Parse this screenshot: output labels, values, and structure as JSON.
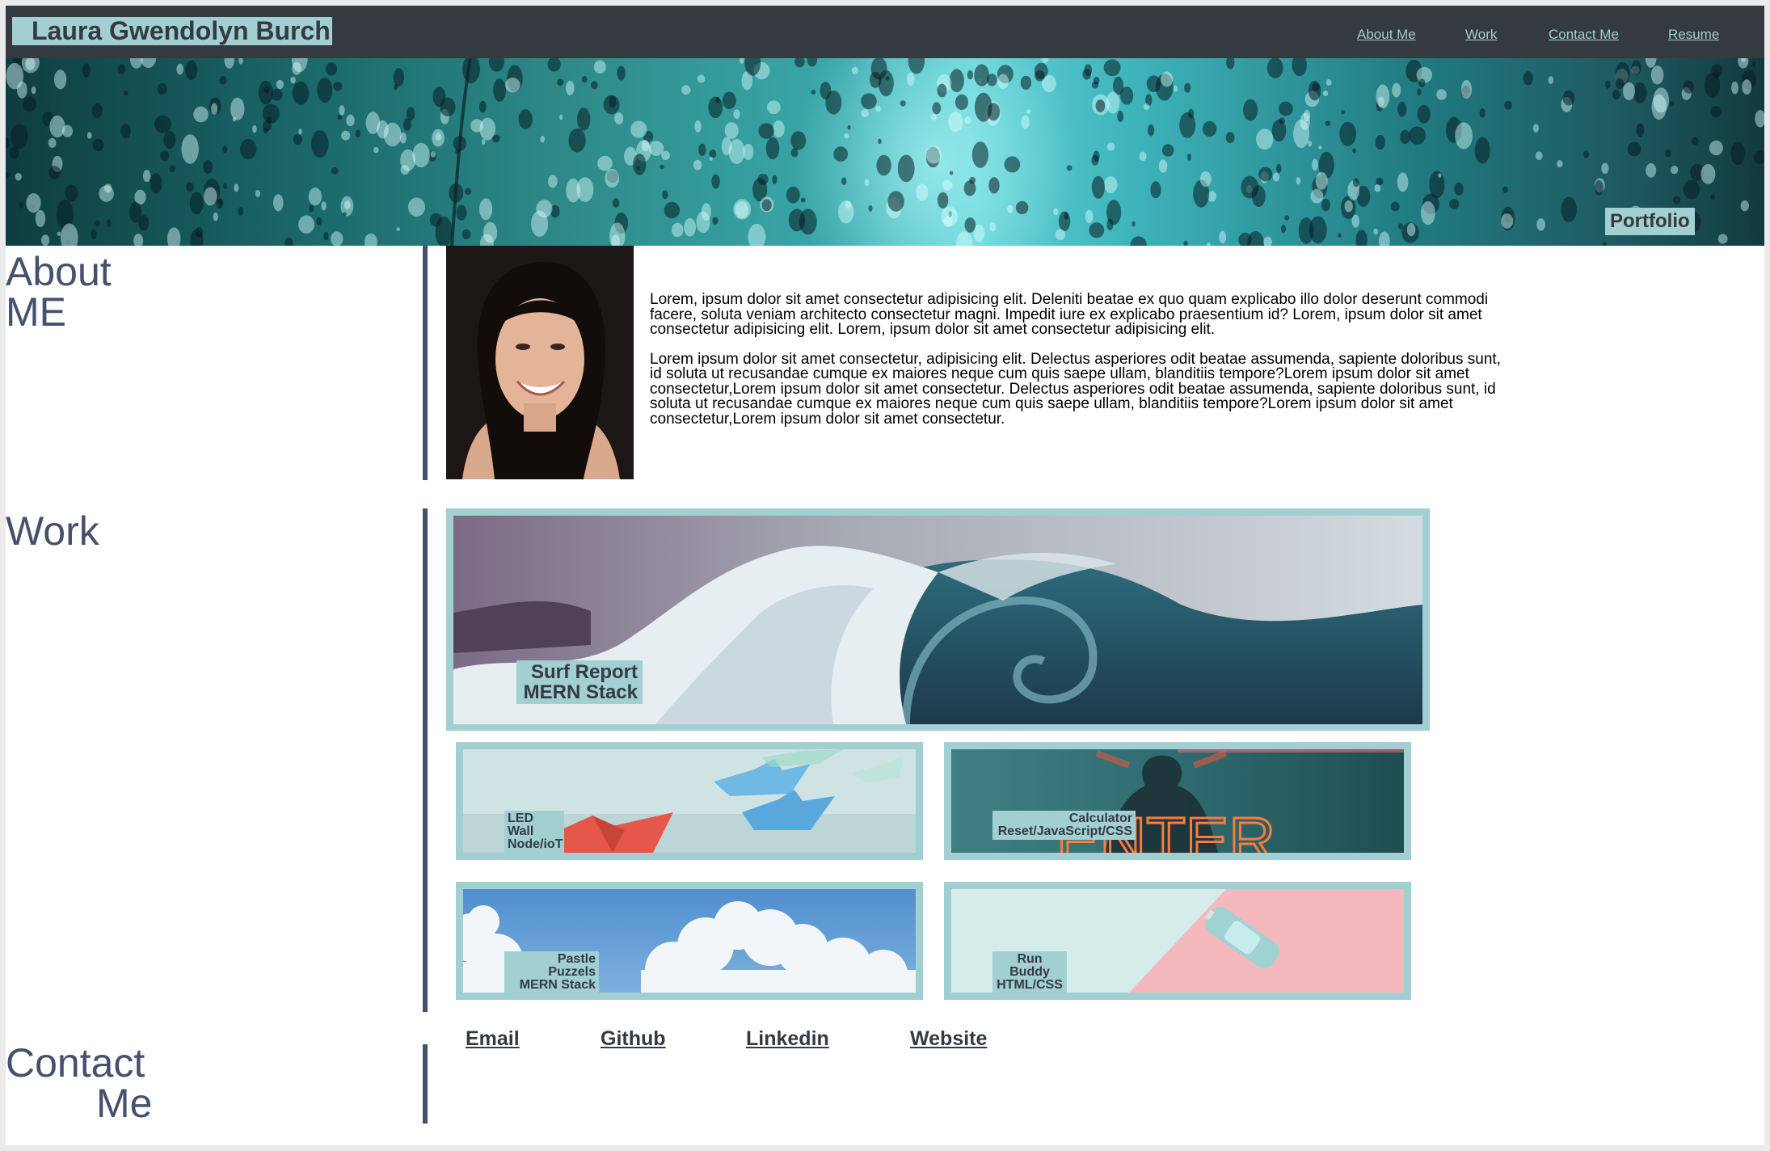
{
  "header": {
    "site_title": "Laura Gwendolyn Burch",
    "nav": [
      "About Me",
      "Work",
      "Contact Me",
      "Resume"
    ]
  },
  "hero": {
    "tag": "Portfolio"
  },
  "about": {
    "heading_line1": "About",
    "heading_line2": "ME",
    "paragraphs": [
      "Lorem, ipsum dolor sit amet consectetur adipisicing elit. Deleniti beatae ex quo quam explicabo illo dolor deserunt commodi facere, soluta veniam architecto consectetur magni. Impedit iure ex explicabo praesentium id? Lorem, ipsum dolor sit amet consectetur adipisicing elit. Lorem, ipsum dolor sit amet consectetur adipisicing elit.",
      "Lorem ipsum dolor sit amet consectetur, adipisicing elit. Delectus asperiores odit beatae assumenda, sapiente doloribus sunt, id soluta ut recusandae cumque ex maiores neque cum quis saepe ullam, blanditiis tempore?Lorem ipsum dolor sit amet consectetur,Lorem ipsum dolor sit amet consectetur. Delectus asperiores odit beatae assumenda, sapiente doloribus sunt, id soluta ut recusandae cumque ex maiores neque cum quis saepe ullam, blanditiis tempore?Lorem ipsum dolor sit amet consectetur,Lorem ipsum dolor sit amet consectetur."
    ]
  },
  "work": {
    "heading": "Work",
    "featured": {
      "line1": "Surf Report",
      "line2": "MERN Stack"
    },
    "projects": [
      {
        "line1": "LED Wall",
        "line2": "Node/ioT"
      },
      {
        "line1": "Calculator",
        "line2": "Reset/JavaScript/CSS"
      },
      {
        "line1": "Pastle Puzzels",
        "line2": "MERN Stack"
      },
      {
        "line1": "Run Buddy",
        "line2": "HTML/CSS"
      }
    ]
  },
  "contact": {
    "heading_line1": "Contact",
    "heading_line2": "Me",
    "links": [
      "Email",
      "Github",
      "Linkedin",
      "Website"
    ]
  },
  "colors": {
    "header_bg": "#343a40",
    "accent": "#a1cfd2",
    "heading": "#44506e"
  }
}
